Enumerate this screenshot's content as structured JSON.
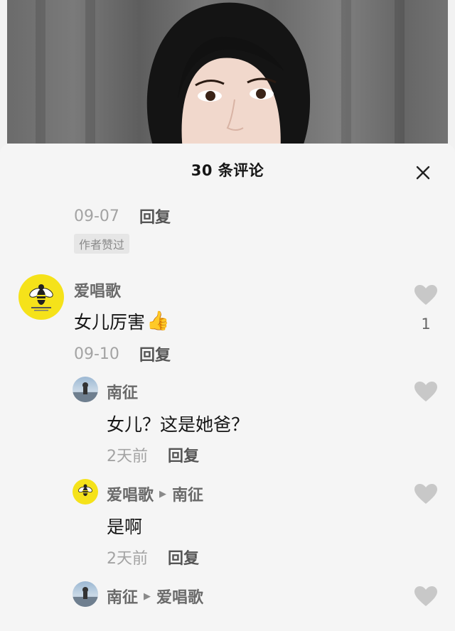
{
  "header": {
    "title": "30 条评论"
  },
  "comments": [
    {
      "date": "09-07",
      "reply_label": "回复",
      "author_liked_badge": "作者赞过"
    },
    {
      "username": "爱唱歌",
      "text": "女儿厉害",
      "emoji": "👍",
      "date": "09-10",
      "reply_label": "回复",
      "like_count": "1",
      "replies": [
        {
          "username": "南征",
          "text": "女儿？这是她爸？",
          "date": "2天前",
          "reply_label": "回复"
        },
        {
          "username": "爱唱歌",
          "reply_to": "南征",
          "text": "是啊",
          "date": "2天前",
          "reply_label": "回复"
        },
        {
          "username": "南征",
          "reply_to": "爱唱歌"
        }
      ]
    }
  ],
  "icons": {
    "close": "close-icon",
    "like": "heart-icon",
    "reply_arrow": "triangle-right-icon"
  },
  "colors": {
    "sheet_bg": "#f5f5f5",
    "avatar_yellow": "#f5e21a",
    "heart_gray": "#c8c8c8"
  }
}
